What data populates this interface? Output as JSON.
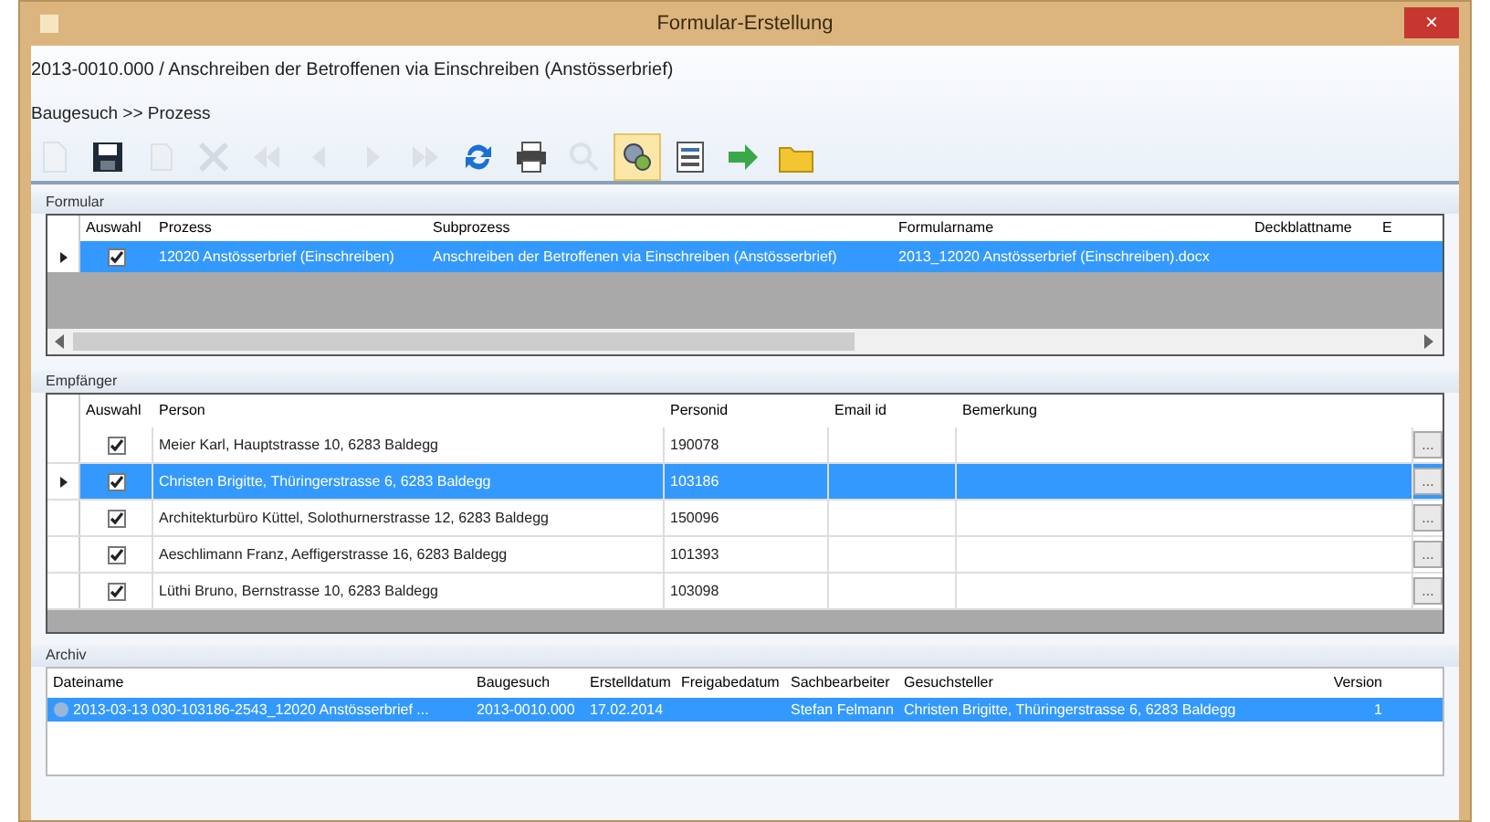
{
  "window": {
    "title": "Formular-Erstellung",
    "close": "×"
  },
  "heading": "2013-0010.000 / Anschreiben der Betroffenen via Einschreiben (Anstösserbrief)",
  "breadcrumb": "Baugesuch >> Prozess",
  "toolbar": [
    {
      "kind": "new",
      "disabled": true,
      "selected": false
    },
    {
      "kind": "save",
      "disabled": false,
      "selected": false
    },
    {
      "kind": "copy",
      "disabled": true,
      "selected": false
    },
    {
      "kind": "delete",
      "disabled": true,
      "selected": false
    },
    {
      "kind": "first",
      "disabled": true,
      "selected": false
    },
    {
      "kind": "prev",
      "disabled": true,
      "selected": false
    },
    {
      "kind": "next",
      "disabled": true,
      "selected": false
    },
    {
      "kind": "last",
      "disabled": true,
      "selected": false
    },
    {
      "kind": "refresh",
      "disabled": false,
      "selected": false
    },
    {
      "kind": "print",
      "disabled": false,
      "selected": false
    },
    {
      "kind": "preview",
      "disabled": true,
      "selected": false
    },
    {
      "kind": "merge",
      "disabled": false,
      "selected": true
    },
    {
      "kind": "table",
      "disabled": false,
      "selected": false
    },
    {
      "kind": "export",
      "disabled": false,
      "selected": false
    },
    {
      "kind": "folder",
      "disabled": false,
      "selected": false
    }
  ],
  "formular": {
    "label": "Formular",
    "columns": [
      "Auswahl",
      "Prozess",
      "Subprozess",
      "Formularname",
      "Deckblattname",
      "E"
    ],
    "rows": [
      {
        "selected": true,
        "checked": true,
        "prozess": "12020 Anstösserbrief (Einschreiben)",
        "subprozess": "Anschreiben der Betroffenen via Einschreiben (Anstösserbrief)",
        "formularname": "2013_12020 Anstösserbrief (Einschreiben).docx"
      }
    ]
  },
  "empfaenger": {
    "label": "Empfänger",
    "columns": [
      "Auswahl",
      "Person",
      "Personid",
      "Email id",
      "Bemerkung"
    ],
    "rows": [
      {
        "selected": false,
        "checked": true,
        "person": "Meier Karl, Hauptstrasse 10, 6283 Baldegg",
        "personid": "190078",
        "action": "..."
      },
      {
        "selected": true,
        "checked": true,
        "person": "Christen Brigitte, Thüringerstrasse 6, 6283 Baldegg",
        "personid": "103186",
        "action": "..."
      },
      {
        "selected": false,
        "checked": true,
        "person": "Architekturbüro Küttel, Solothurnerstrasse 12, 6283 Baldegg",
        "personid": "150096",
        "action": "..."
      },
      {
        "selected": false,
        "checked": true,
        "person": "Aeschlimann Franz, Aeffigerstrasse 16, 6283 Baldegg",
        "personid": "101393",
        "action": "..."
      },
      {
        "selected": false,
        "checked": true,
        "person": "Lüthi Bruno, Bernstrasse 10, 6283 Baldegg",
        "personid": "103098",
        "action": "..."
      }
    ]
  },
  "archiv": {
    "label": "Archiv",
    "columns": [
      "Dateiname",
      "Baugesuch",
      "Erstelldatum",
      "Freigabedatum",
      "Sachbearbeiter",
      "Gesuchsteller",
      "Version"
    ],
    "rows": [
      {
        "selected": true,
        "cells": [
          "2013-03-13 030-103186-2543_12020 Anstösserbrief ...",
          "2013-0010.000",
          "17.02.2014",
          "",
          "Stefan Felmann",
          "Christen Brigitte, Thüringerstrasse 6, 6283 Baldegg",
          "1"
        ]
      }
    ]
  }
}
